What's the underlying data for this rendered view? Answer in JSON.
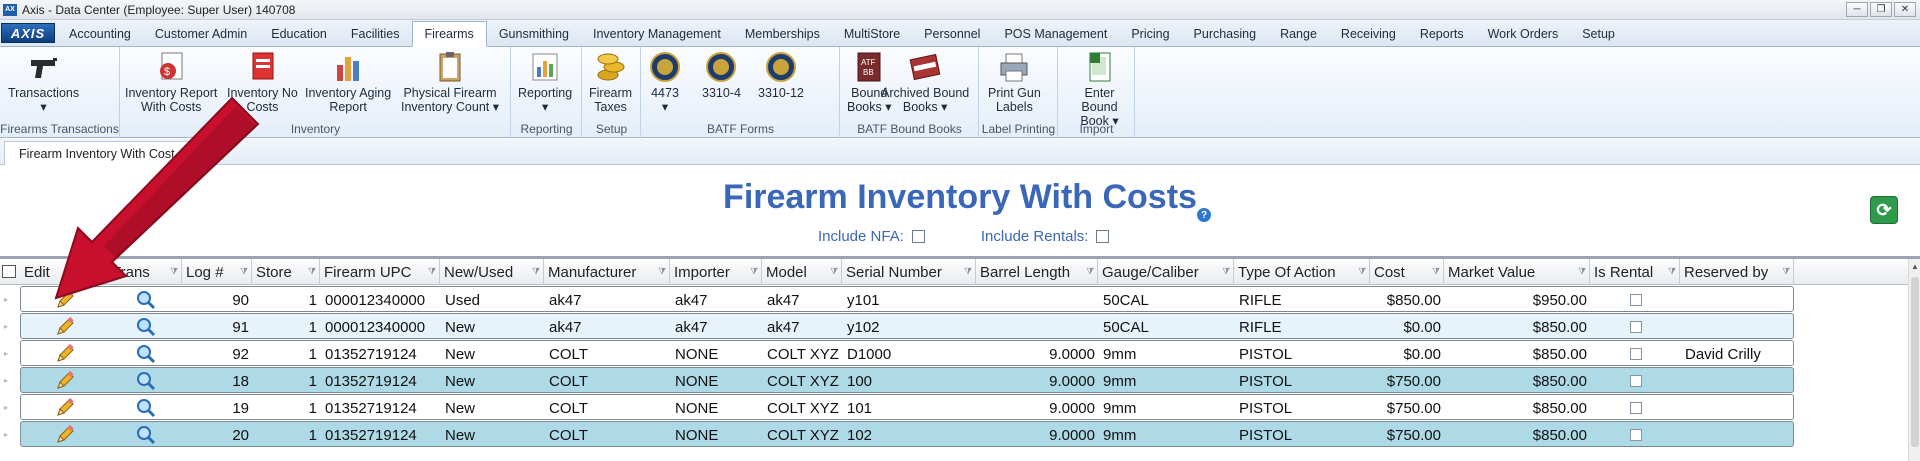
{
  "window": {
    "title": "Axis - Data Center  (Employee: Super User) 140708"
  },
  "logo_text": "AXIS",
  "menu_tabs": [
    "Accounting",
    "Customer Admin",
    "Education",
    "Facilities",
    "Firearms",
    "Gunsmithing",
    "Inventory Management",
    "Memberships",
    "MultiStore",
    "Personnel",
    "POS Management",
    "Pricing",
    "Purchasing",
    "Range",
    "Receiving",
    "Reports",
    "Work Orders",
    "Setup"
  ],
  "active_tab": "Firearms",
  "ribbon": {
    "groups": [
      {
        "label": "Firearms Transactions",
        "buttons": [
          {
            "l1": "Transactions",
            "l2": "▾",
            "icon": "pistol-icon"
          }
        ]
      },
      {
        "label": "Inventory",
        "buttons": [
          {
            "l1": "Inventory Report",
            "l2": "With Costs",
            "icon": "report-dollar-icon"
          },
          {
            "l1": "Inventory No",
            "l2": "Costs",
            "icon": "report-red-icon"
          },
          {
            "l1": "Inventory Aging",
            "l2": "Report",
            "icon": "bar-chart-icon"
          },
          {
            "l1": "Physical Firearm",
            "l2": "Inventory Count ▾",
            "icon": "clipboard-icon"
          }
        ]
      },
      {
        "label": "Reporting",
        "buttons": [
          {
            "l1": "Reporting",
            "l2": "▾",
            "icon": "chart-icon"
          }
        ]
      },
      {
        "label": "Setup",
        "buttons": [
          {
            "l1": "Firearm",
            "l2": "Taxes",
            "icon": "coins-icon"
          }
        ]
      },
      {
        "label": "BATF Forms",
        "buttons": [
          {
            "l1": "4473",
            "l2": "▾",
            "icon": "seal-icon"
          },
          {
            "l1": "3310-4",
            "l2": "",
            "icon": "seal-icon"
          },
          {
            "l1": "3310-12",
            "l2": "",
            "icon": "seal-icon"
          }
        ]
      },
      {
        "label": "BATF Bound Books",
        "buttons": [
          {
            "l1": "Bound",
            "l2": "Books ▾",
            "icon": "atf-book-icon"
          },
          {
            "l1": "Archived Bound",
            "l2": "Books ▾",
            "icon": "archived-book-icon"
          }
        ]
      },
      {
        "label": "Label Printing",
        "buttons": [
          {
            "l1": "Print Gun",
            "l2": "Labels",
            "icon": "printer-icon"
          }
        ]
      },
      {
        "label": "Import",
        "buttons": [
          {
            "l1": "Enter Bound",
            "l2": "Book ▾",
            "icon": "excel-icon"
          }
        ]
      }
    ]
  },
  "doc_tab": "Firearm Inventory With Cost",
  "page_title": "Firearm Inventory With Costs",
  "filters": {
    "nfa_label": "Include NFA:",
    "rentals_label": "Include Rentals:"
  },
  "grid": {
    "columns": [
      "Edit",
      "Trans",
      "Log #",
      "Store",
      "Firearm UPC",
      "New/Used",
      "Manufacturer",
      "Importer",
      "Model",
      "Serial Number",
      "Barrel Length",
      "Gauge/Caliber",
      "Type Of Action",
      "Cost",
      "Market Value",
      "Is Rental",
      "Reserved by"
    ],
    "rows": [
      {
        "log": "90",
        "store": "1",
        "upc": "000012340000",
        "new_used": "Used",
        "mfr": "ak47",
        "importer": "ak47",
        "model": "ak47",
        "serial": "y101",
        "barrel": "",
        "gauge": "50CAL",
        "action": "RIFLE",
        "cost": "$850.00",
        "market": "$950.00",
        "reserved": ""
      },
      {
        "log": "91",
        "store": "1",
        "upc": "000012340000",
        "new_used": "New",
        "mfr": "ak47",
        "importer": "ak47",
        "model": "ak47",
        "serial": "y102",
        "barrel": "",
        "gauge": "50CAL",
        "action": "RIFLE",
        "cost": "$0.00",
        "market": "$850.00",
        "reserved": ""
      },
      {
        "log": "92",
        "store": "1",
        "upc": "01352719124",
        "new_used": "New",
        "mfr": "COLT",
        "importer": "NONE",
        "model": "COLT XYZ",
        "serial": "D1000",
        "barrel": "9.0000",
        "gauge": "9mm",
        "action": "PISTOL",
        "cost": "$0.00",
        "market": "$850.00",
        "reserved": "David Crilly"
      },
      {
        "log": "18",
        "store": "1",
        "upc": "01352719124",
        "new_used": "New",
        "mfr": "COLT",
        "importer": "NONE",
        "model": "COLT XYZ",
        "serial": "100",
        "barrel": "9.0000",
        "gauge": "9mm",
        "action": "PISTOL",
        "cost": "$750.00",
        "market": "$850.00",
        "reserved": ""
      },
      {
        "log": "19",
        "store": "1",
        "upc": "01352719124",
        "new_used": "New",
        "mfr": "COLT",
        "importer": "NONE",
        "model": "COLT XYZ",
        "serial": "101",
        "barrel": "9.0000",
        "gauge": "9mm",
        "action": "PISTOL",
        "cost": "$750.00",
        "market": "$850.00",
        "reserved": ""
      },
      {
        "log": "20",
        "store": "1",
        "upc": "01352719124",
        "new_used": "New",
        "mfr": "COLT",
        "importer": "NONE",
        "model": "COLT XYZ",
        "serial": "102",
        "barrel": "9.0000",
        "gauge": "9mm",
        "action": "PISTOL",
        "cost": "$750.00",
        "market": "$850.00",
        "reserved": ""
      }
    ]
  },
  "colors": {
    "title": "#3a67b8",
    "row_alt": "#aed9e6",
    "arrow": "#c8102e",
    "refresh": "#2f9b4a"
  }
}
